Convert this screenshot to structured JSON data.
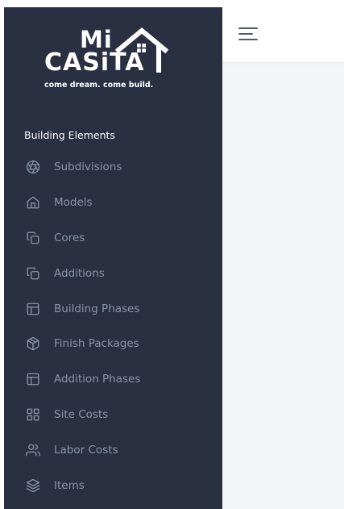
{
  "brand": {
    "line1": "Mi",
    "line2": "CASiTA",
    "tagline": "come dream. come build."
  },
  "sidebar": {
    "section_title": "Building Elements",
    "items": [
      {
        "label": "Subdivisions",
        "icon": "aperture-icon"
      },
      {
        "label": "Models",
        "icon": "home-icon"
      },
      {
        "label": "Cores",
        "icon": "copy-icon"
      },
      {
        "label": "Additions",
        "icon": "copy-icon"
      },
      {
        "label": "Building Phases",
        "icon": "layout-icon"
      },
      {
        "label": "Finish Packages",
        "icon": "package-icon"
      },
      {
        "label": "Addition Phases",
        "icon": "layout-icon"
      },
      {
        "label": "Site Costs",
        "icon": "grid-icon"
      },
      {
        "label": "Labor Costs",
        "icon": "users-icon"
      },
      {
        "label": "Items",
        "icon": "layers-icon"
      }
    ]
  },
  "topbar": {
    "menu_icon": "hamburger-menu-icon"
  },
  "colors": {
    "sidebar_bg": "#2a3042",
    "nav_text": "#8b94a9",
    "content_bg": "#f4f5f9"
  }
}
